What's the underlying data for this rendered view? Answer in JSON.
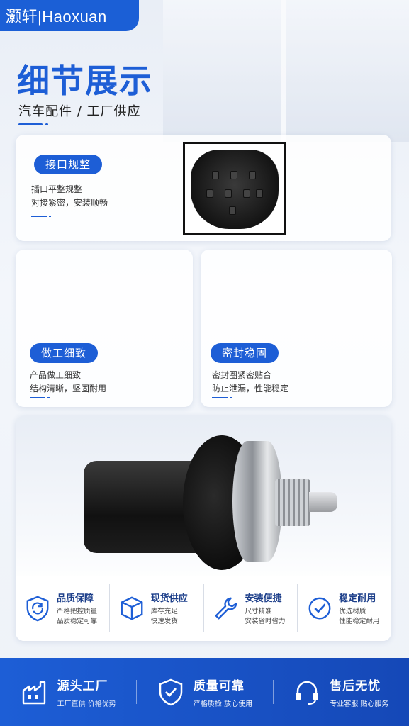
{
  "brand": "灏轩|Haoxuan",
  "header": {
    "title": "细节展示",
    "subtitle": "汽车配件 / 工厂供应"
  },
  "cards": [
    {
      "tag": "接口规整",
      "lines": [
        "插口平整规整",
        "对接紧密，安装顺畅"
      ]
    },
    {
      "tag": "做工细致",
      "lines": [
        "产品做工细致",
        "结构清晰，坚固耐用"
      ]
    },
    {
      "tag": "密封稳固",
      "lines": [
        "密封圈紧密贴合",
        "防止泄漏，性能稳定"
      ]
    }
  ],
  "features": [
    {
      "icon": "shield-refresh-icon",
      "title": "品质保障",
      "lines": [
        "严格把控质量",
        "品质稳定可靠"
      ]
    },
    {
      "icon": "box-icon",
      "title": "现货供应",
      "lines": [
        "库存充足",
        "快速发货"
      ]
    },
    {
      "icon": "wrench-icon",
      "title": "安装便捷",
      "lines": [
        "尺寸精准",
        "安装省时省力"
      ]
    },
    {
      "icon": "check-badge-icon",
      "title": "稳定耐用",
      "lines": [
        "优选材质",
        "性能稳定耐用"
      ]
    }
  ],
  "bottom": [
    {
      "icon": "factory-icon",
      "title": "源头工厂",
      "sub": "工厂直供 价格优势"
    },
    {
      "icon": "shield-check-icon",
      "title": "质量可靠",
      "sub": "严格质检 放心使用"
    },
    {
      "icon": "headset-icon",
      "title": "售后无忧",
      "sub": "专业客服 贴心服务"
    }
  ],
  "colors": {
    "accent": "#1d5ed6",
    "dark_text": "#1d3f8a"
  }
}
